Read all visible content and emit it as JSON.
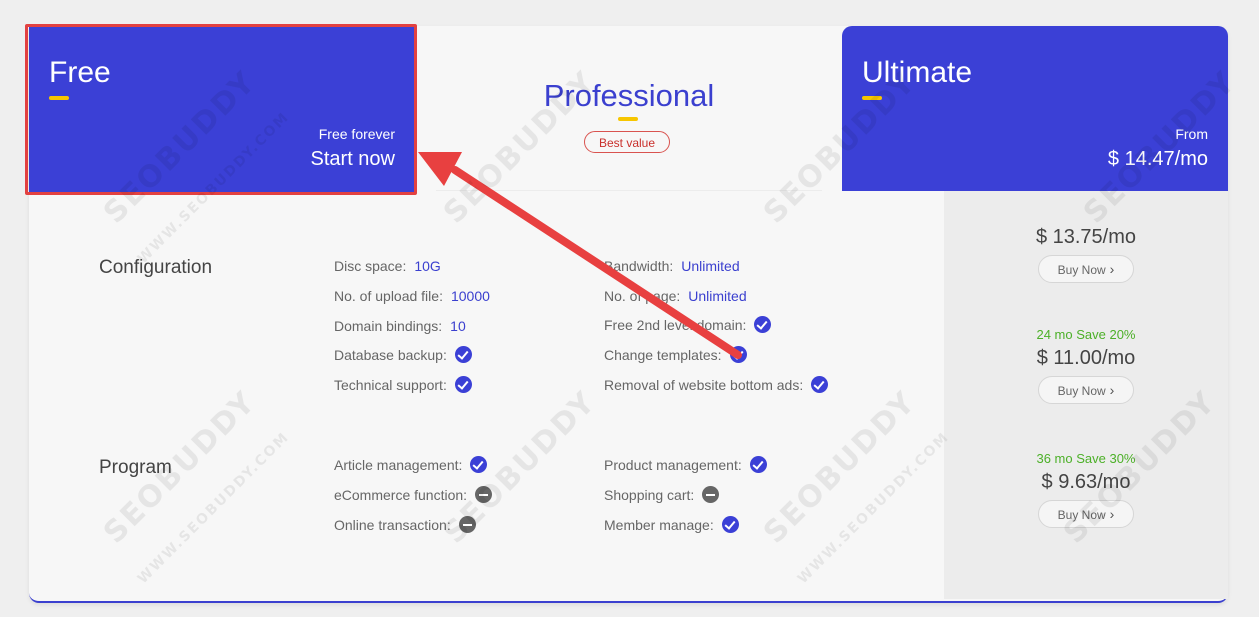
{
  "plans": {
    "free": {
      "title": "Free",
      "subtitle": "Free forever",
      "cta": "Start now"
    },
    "professional": {
      "title": "Professional",
      "badge": "Best value"
    },
    "ultimate": {
      "title": "Ultimate",
      "subtitle": "From",
      "price": "$ 14.47/mo"
    }
  },
  "pricing": [
    {
      "save": "",
      "price": "$ 13.75/mo",
      "button": "Buy Now"
    },
    {
      "save": "24 mo Save 20%",
      "price": "$ 11.00/mo",
      "button": "Buy Now"
    },
    {
      "save": "36 mo Save 30%",
      "price": "$ 9.63/mo",
      "button": "Buy Now"
    }
  ],
  "sections": {
    "configuration": {
      "title": "Configuration",
      "left": [
        {
          "label": "Disc space:",
          "value": "10G"
        },
        {
          "label": "No. of upload file:",
          "value": "10000"
        },
        {
          "label": "Domain bindings:",
          "value": "10"
        },
        {
          "label": "Database backup:",
          "icon": "check-icon"
        },
        {
          "label": "Technical support:",
          "icon": "check-icon"
        }
      ],
      "right": [
        {
          "label": "Bandwidth:",
          "value": "Unlimited"
        },
        {
          "label": "No. of page:",
          "value": "Unlimited"
        },
        {
          "label": "Free 2nd level domain:",
          "icon": "check-icon"
        },
        {
          "label": "Change templates:",
          "icon": "check-icon"
        },
        {
          "label": "Removal of website bottom ads:",
          "icon": "check-icon"
        }
      ]
    },
    "program": {
      "title": "Program",
      "left": [
        {
          "label": "Article management:",
          "icon": "check-icon"
        },
        {
          "label": "eCommerce function:",
          "icon": "minus-icon"
        },
        {
          "label": "Online transaction:",
          "icon": "minus-icon"
        }
      ],
      "right": [
        {
          "label": "Product management:",
          "icon": "check-icon"
        },
        {
          "label": "Shopping cart:",
          "icon": "minus-icon"
        },
        {
          "label": "Member manage:",
          "icon": "check-icon"
        }
      ]
    }
  },
  "watermark": "SEOBUDDY",
  "watermark_sub": "WWW.SEOBUDDY.COM",
  "colors": {
    "accent": "#3b40d6",
    "highlight": "#e24141",
    "underline": "#f7c600",
    "save": "#4cb028"
  }
}
